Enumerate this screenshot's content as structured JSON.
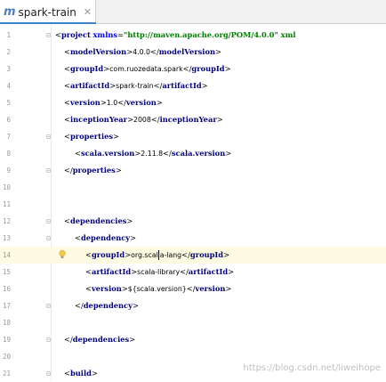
{
  "tab": {
    "icon": "maven-icon",
    "label": "spark-train",
    "close_icon": "close-icon"
  },
  "colors": {
    "tag": "#000080",
    "attribute": "#0000ff",
    "value": "#008000",
    "line_number": "#999999",
    "active_line": "#fdfbe2"
  },
  "lines": {
    "1": {
      "number": "1"
    },
    "2": {
      "number": "2"
    },
    "3": {
      "number": "3"
    },
    "4": {
      "number": "4"
    },
    "5": {
      "number": "5"
    },
    "6": {
      "number": "6"
    },
    "7": {
      "number": "7"
    },
    "8": {
      "number": "8"
    },
    "9": {
      "number": "9"
    },
    "10": {
      "number": "10"
    },
    "11": {
      "number": "11"
    },
    "12": {
      "number": "12"
    },
    "13": {
      "number": "13"
    },
    "14": {
      "number": "14"
    },
    "15": {
      "number": "15"
    },
    "16": {
      "number": "16"
    },
    "17": {
      "number": "17"
    },
    "18": {
      "number": "18"
    },
    "19": {
      "number": "19"
    },
    "20": {
      "number": "20"
    },
    "21": {
      "number": "21"
    }
  },
  "code": {
    "project_tag": "project",
    "xmlns_attr": "xmlns",
    "xmlns_value": "\"http://maven.apache.org/POM/4.0.0\" xml",
    "modelVersion_tag": "modelVersion",
    "modelVersion_value": "4.0.0",
    "groupId_tag": "groupId",
    "groupId_value": "com.ruozedata.spark",
    "artifactId_tag": "artifactId",
    "artifactId_value": "spark-train",
    "version_tag": "version",
    "version_value": "1.0",
    "inceptionYear_tag": "inceptionYear",
    "inceptionYear_value": "2008",
    "properties_tag": "properties",
    "scala_version_tag": "scala.version",
    "scala_version_value": "2.11.8",
    "dependencies_tag": "dependencies",
    "dependency_tag": "dependency",
    "dep_groupId_value_a": "org.scal",
    "dep_groupId_value_b": "a-lang",
    "dep_artifactId_value": "scala-library",
    "dep_version_value": "${scala.version}",
    "build_tag": "build"
  },
  "watermark": "https://blog.csdn.net/liweihope"
}
